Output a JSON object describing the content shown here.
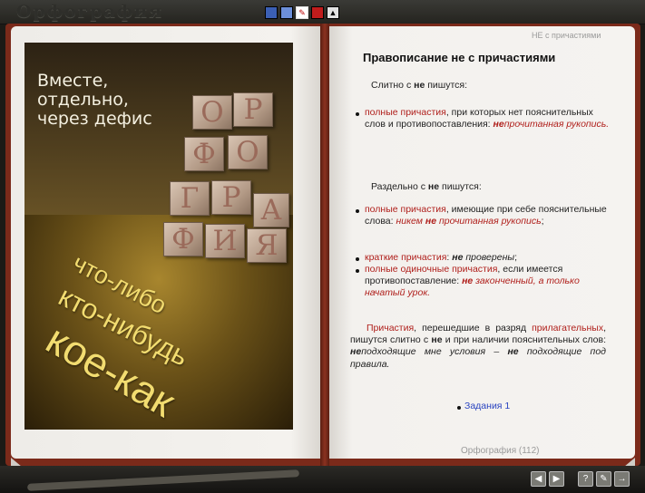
{
  "window": {
    "title": "Орфография",
    "tabs": [
      {
        "name": "tab-1",
        "label": ""
      },
      {
        "name": "tab-2",
        "label": ""
      },
      {
        "name": "tab-3",
        "label": "✎"
      },
      {
        "name": "tab-4",
        "label": ""
      },
      {
        "name": "tab-5",
        "label": "▲"
      }
    ]
  },
  "left_page": {
    "heading": [
      "Вместе,",
      "отдельно,",
      "через дефис"
    ],
    "blocks": [
      "О",
      "Р",
      "Ф",
      "О",
      "Г",
      "Р",
      "А",
      "Ф",
      "И",
      "Я"
    ],
    "diagonal": [
      "что-либо",
      "кто-нибудь",
      "кое-как"
    ]
  },
  "right_page": {
    "header": "НЕ с причастиями",
    "title": "Правописание не с причастиями",
    "together_intro_a": "Слитно с",
    "together_intro_b": "не",
    "together_intro_c": "пишутся:",
    "b1_link": "полные причастия",
    "b1_text": ", при которых нет пояснительных слов и противопоставления:",
    "b1_ex_ne": "не",
    "b1_ex": "прочитанная рукопись.",
    "separate_intro_a": "Раздельно с",
    "separate_intro_b": "не",
    "separate_intro_c": "пишутся:",
    "b2_link": "полные причастия",
    "b2_text": ", имеющие при себе пояснительные слова:",
    "b2_ex_a": "никем",
    "b2_ex_ne": "не",
    "b2_ex_b": "прочитанная рукопись",
    "b2_end": ";",
    "b3_link": "краткие причастия",
    "b3_text": ":",
    "b3_ex_ne": "не",
    "b3_ex": "проверены",
    "b3_end": ";",
    "b4_link": "полные одиночные причастия",
    "b4_text": ", если имеется противопоставление:",
    "b4_ex_ne": "не",
    "b4_ex": "законченный, а только начатый урок.",
    "para_link1": "Причастия",
    "para_text1": ", перешедшие в разряд",
    "para_link2": "прилагательных",
    "para_text2": ", пишутся слитно с",
    "para_ne": "не",
    "para_text3": "и при наличии пояснительных слов:",
    "para_ex1_ne": "не",
    "para_ex1": "подходящие мне условия –",
    "para_ex2_ne": "не",
    "para_ex2": "подходящие под правила.",
    "task_link": "Задания 1",
    "footer": "Орфография (112)"
  },
  "toolbar": {
    "buttons": [
      "◀",
      "▶",
      "?",
      "✎",
      "→"
    ]
  },
  "colors": {
    "accent_red": "#b0201c",
    "link_blue": "#2a44c0",
    "book_cover": "#7b2a1a",
    "diagonal_text": "#f2dc70"
  }
}
